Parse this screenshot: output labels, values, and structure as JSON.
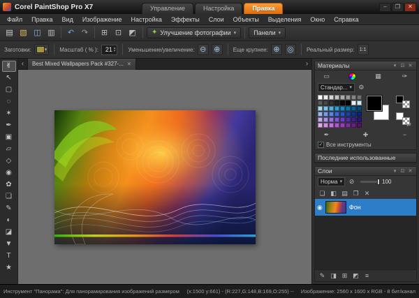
{
  "colors": {
    "accent_orange": "#ef8422",
    "layer_selection_blue": "#2d7ec9",
    "canvas_gray": "#6e6e6e"
  },
  "ui": {
    "caret": "▾",
    "check": "✓",
    "close": "✕",
    "spin_up": "▴",
    "spin_down": "▾",
    "swap": "⇄",
    "lock": "⊘",
    "eye": "◉",
    "tab_prev": "‹",
    "tab_next": "›",
    "settings": "⚙",
    "enhance": "✦"
  },
  "titlebar": {
    "title": "Corel PaintShop Pro X7",
    "tabs": [
      {
        "label": "Управление"
      },
      {
        "label": "Настройка"
      },
      {
        "label": "Правка"
      }
    ],
    "active_tab": 2,
    "window_controls": [
      {
        "name": "minimize-button",
        "glyph": "–"
      },
      {
        "name": "maximize-button",
        "glyph": "❐"
      },
      {
        "name": "close-button",
        "glyph": "✕"
      }
    ]
  },
  "menu": {
    "items": [
      "Файл",
      "Правка",
      "Вид",
      "Изображение",
      "Настройка",
      "Эффекты",
      "Слои",
      "Объекты",
      "Выделения",
      "Окно",
      "Справка"
    ]
  },
  "toolbar": {
    "buttons": [
      {
        "name": "new-image-button",
        "glyph": "▤",
        "color": "#cfcfcf"
      },
      {
        "name": "open-image-button",
        "glyph": "▧",
        "color": "#d9b964"
      },
      {
        "name": "save-button",
        "glyph": "◫",
        "color": "#8fb1dd"
      },
      {
        "name": "print-button",
        "glyph": "▥",
        "color": "#bcbcbc"
      },
      {
        "sep": true
      },
      {
        "name": "undo-button",
        "glyph": "↶",
        "color": "#6fa3e3"
      },
      {
        "name": "redo-button",
        "glyph": "↷",
        "color": "#9c9c9c"
      },
      {
        "sep": true
      },
      {
        "name": "resize-button",
        "glyph": "⊞",
        "color": "#bcbcbc"
      },
      {
        "name": "screen-capture-button",
        "glyph": "⊡",
        "color": "#bcbcbc"
      },
      {
        "name": "palettes-button",
        "glyph": "◩",
        "color": "#bcbcbc"
      }
    ],
    "enhance_label": "Улучшение фотографии",
    "panels_label": "Панели"
  },
  "options": {
    "presets_label": "Заготовки:",
    "zoom_label": "Масштаб ( % ):",
    "zoom_value": "21",
    "zoom_io_label": "Уменьшение/увеличение:",
    "zoom_out_icon": "⊖",
    "zoom_in_icon": "⊕",
    "larger_label": "Еще крупнее:",
    "larger_icon": "⊕",
    "larger_icon2": "◎",
    "actual_label": "Реальный размер:",
    "actual_icon": "1:1"
  },
  "tools": {
    "active": 0,
    "items": [
      {
        "name": "pan-tool",
        "glyph": "✌"
      },
      {
        "name": "pick-tool",
        "glyph": "↖"
      },
      {
        "name": "selection-tool",
        "glyph": "▢"
      },
      {
        "name": "freehand-selection-tool",
        "glyph": "◌"
      },
      {
        "name": "magic-wand-tool",
        "glyph": "✶"
      },
      {
        "name": "dropper-tool",
        "glyph": "✒"
      },
      {
        "name": "crop-tool",
        "glyph": "▣"
      },
      {
        "name": "straighten-tool",
        "glyph": "▱"
      },
      {
        "name": "perspective-tool",
        "glyph": "◇"
      },
      {
        "name": "red-eye-tool",
        "glyph": "◉"
      },
      {
        "name": "makeover-tool",
        "glyph": "✿"
      },
      {
        "name": "clone-tool",
        "glyph": "❏"
      },
      {
        "name": "paint-brush-tool",
        "glyph": "✎"
      },
      {
        "name": "lighten-darken-tool",
        "glyph": "◐"
      },
      {
        "name": "eraser-tool",
        "glyph": "◪"
      },
      {
        "name": "flood-fill-tool",
        "glyph": "▼"
      },
      {
        "name": "text-tool",
        "glyph": "T"
      },
      {
        "name": "preset-shapes-tool",
        "glyph": "★"
      }
    ]
  },
  "document": {
    "tab_title": "Best Mixed Wallpapers Pack #327-..."
  },
  "panel_header_icons": [
    {
      "name": "panel-menu-icon",
      "glyph": "▾"
    },
    {
      "name": "panel-float-icon",
      "glyph": "⊡"
    },
    {
      "name": "panel-close-icon",
      "glyph": "✕"
    }
  ],
  "materials": {
    "title": "Материалы",
    "view_icons": [
      {
        "name": "frame-tab-icon",
        "glyph": "▭"
      },
      {
        "name": "rainbow-tab-icon",
        "wheel": true
      },
      {
        "name": "swatches-tab-icon",
        "glyph": "▦"
      },
      {
        "name": "format-brush-icon",
        "glyph": "✑"
      }
    ],
    "palette_value": "Стандар...",
    "swatch_rows": [
      [
        "#ffffff",
        "#ebebeb",
        "#d6d6d6",
        "#c2c2c2",
        "#adadad",
        "#999999",
        "#858585",
        "#707070"
      ],
      [
        "#5c5c5c",
        "#474747",
        "#333333",
        "#1f1f1f",
        "#0a0a0a",
        "#000000",
        "#e8f4fa",
        "#d0eaf6"
      ],
      [
        "#a8d8ee",
        "#7cc4e6",
        "#54b0de",
        "#2e9cd6",
        "#1888c6",
        "#0f74ae",
        "#086096",
        "#044c7e"
      ],
      [
        "#9ab4ec",
        "#7a9ce6",
        "#5a84e0",
        "#3a6cd8",
        "#2656c2",
        "#1844aa",
        "#0e3492",
        "#08267a"
      ],
      [
        "#c4aaec",
        "#ad8ee6",
        "#9672e0",
        "#7f56d8",
        "#6840c2",
        "#532eaa",
        "#402092",
        "#30147a"
      ],
      [
        "#e0aae8",
        "#d08ee0",
        "#c072d8",
        "#b056d0",
        "#9840b8",
        "#802ea0",
        "#682088",
        "#501470"
      ]
    ],
    "action_icons": [
      {
        "name": "dropper-icon",
        "glyph": "✒"
      },
      {
        "name": "add-color-icon",
        "glyph": "✚"
      },
      {
        "name": "remove-color-icon",
        "glyph": "−"
      }
    ],
    "all_tools_checked": true,
    "all_tools_label": "Все инструменты",
    "recent_title": "Последние использованные"
  },
  "layers": {
    "title": "Слои",
    "blend_mode": "Норма",
    "opacity": "100",
    "layer_name": "Фон",
    "toolbar_icons": [
      {
        "name": "new-layer-icon",
        "glyph": "❏"
      },
      {
        "name": "new-mask-layer-icon",
        "glyph": "◧"
      },
      {
        "name": "new-layer-group-icon",
        "glyph": "▤"
      },
      {
        "name": "duplicate-layer-icon",
        "glyph": "❐"
      },
      {
        "name": "delete-layer-icon",
        "glyph": "✕"
      }
    ],
    "bottom_icons": [
      {
        "name": "edit-selectively-icon",
        "glyph": "✎"
      },
      {
        "name": "blend-ranges-icon",
        "glyph": "◨"
      },
      {
        "name": "link-layers-icon",
        "glyph": "⊞"
      },
      {
        "name": "layer-styles-icon",
        "glyph": "◩"
      },
      {
        "name": "more-options-icon",
        "glyph": "≡"
      }
    ]
  },
  "status": {
    "tool_hint": "Инструмент \"Панорама\": Для панорамирования изображений размером больше окна ще...",
    "pointer_info": "(x:1500 y:661) - (R:227,G:148,B:169,O:255) --",
    "image_info": "Изображение: 2560 x 1600 x RGB - 8 бит/канал"
  }
}
